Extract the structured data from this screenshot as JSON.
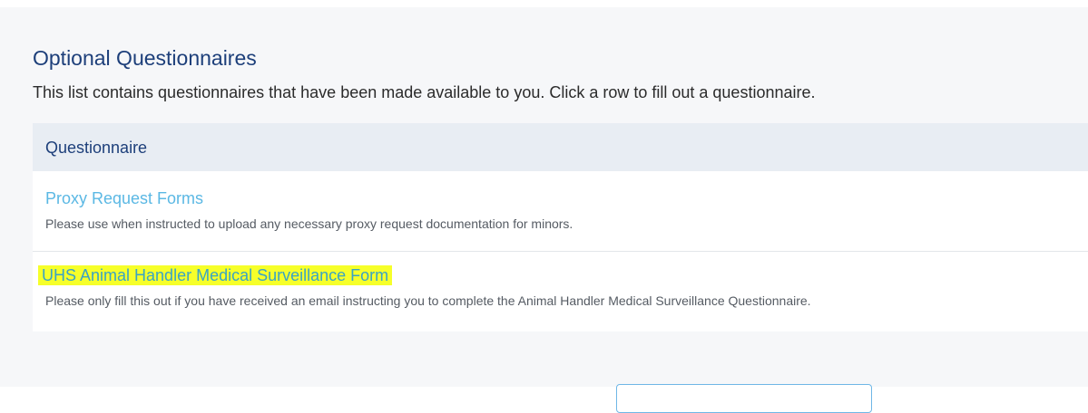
{
  "section": {
    "title": "Optional Questionnaires",
    "description": "This list contains questionnaires that have been made available to you. Click a row to fill out a questionnaire."
  },
  "table": {
    "header": "Questionnaire",
    "rows": [
      {
        "title": "Proxy Request Forms",
        "description": "Please use when instructed to upload any necessary proxy request documentation for minors."
      },
      {
        "title": "UHS Animal Handler Medical Surveillance Form",
        "description": "Please only fill this out if you have received an email instructing you to complete the Animal Handler Medical Surveillance Questionnaire.",
        "highlighted": true
      }
    ]
  },
  "colors": {
    "title": "#1d3f7a",
    "link": "#5bb8e4",
    "highlight": "#f6ff2a",
    "header_bg": "#e8edf3",
    "panel_bg": "#f6f7f9"
  }
}
